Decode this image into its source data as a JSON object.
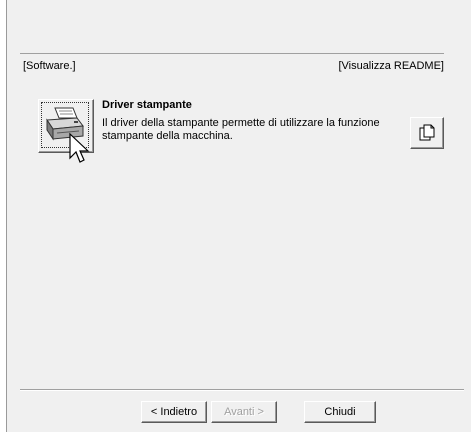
{
  "header": {
    "left_label": "[Software.]",
    "right_label": "[Visualizza README]"
  },
  "entry": {
    "icon": "printer-icon",
    "title": "Driver stampante",
    "description": "Il driver della stampante permette di utilizzare la funzione stampante della macchina.",
    "readme_icon": "document-icon"
  },
  "buttons": {
    "back": "< Indietro",
    "next": "Avanti >",
    "close": "Chiudi"
  }
}
